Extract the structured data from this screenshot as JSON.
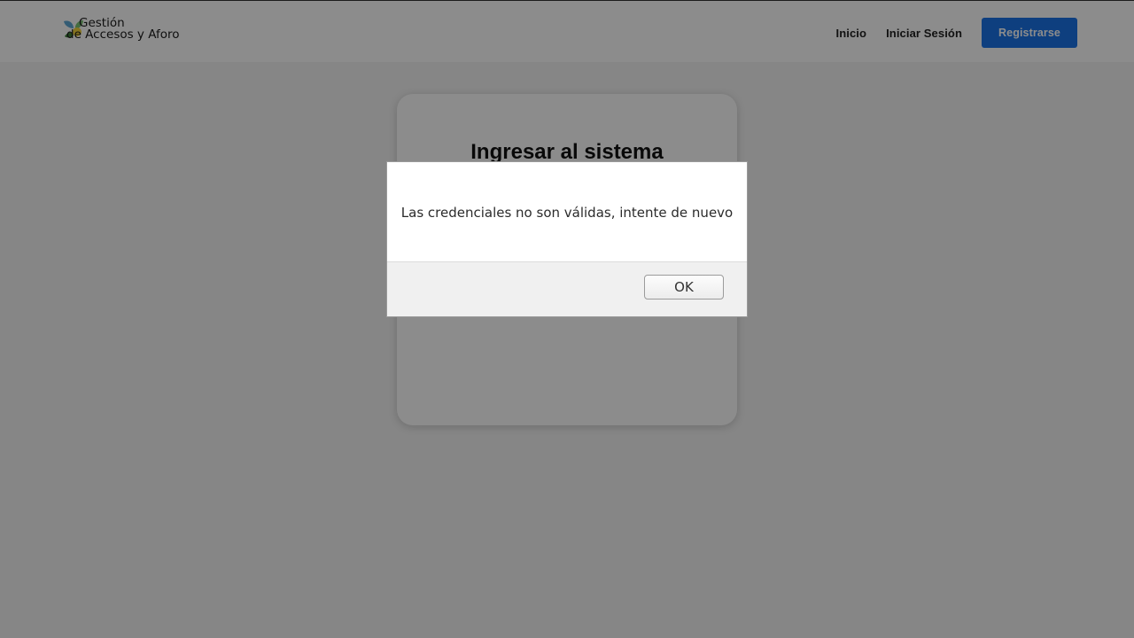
{
  "brand": {
    "line1": "Gestión",
    "line2": "de Accesos y Aforo",
    "icon": "leaf-logo-icon"
  },
  "nav": {
    "home": "Inicio",
    "login": "Iniciar Sesión",
    "register": "Registrarse"
  },
  "login_card": {
    "title": "Ingresar al sistema"
  },
  "dialog": {
    "message": "Las credenciales no son válidas, intente de nuevo",
    "ok": "OK"
  },
  "colors": {
    "accent": "#1a73e8",
    "overlay": "rgba(0,0,0,0.45)"
  }
}
